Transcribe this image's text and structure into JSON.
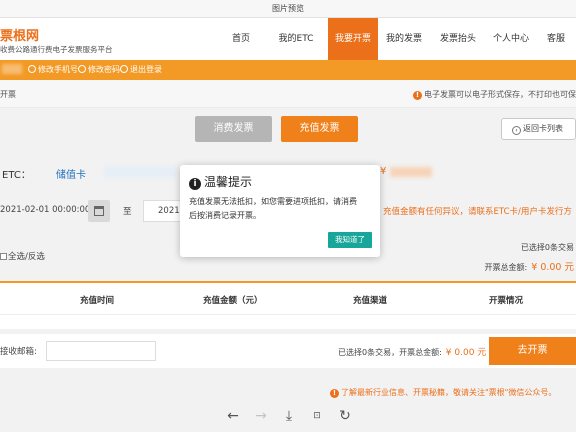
{
  "viewer": {
    "title": "图片预览",
    "tools": [
      "left-arrow-icon",
      "right-arrow-icon",
      "download-icon",
      "fit-icon",
      "rotate-icon"
    ]
  },
  "header": {
    "logo_title": "票根网",
    "logo_subtitle": "收费公路通行费电子发票服务平台",
    "nav": [
      "首页",
      "我的ETC",
      "我要开票",
      "我的发票",
      "发票抬头",
      "个人中心",
      "客服"
    ],
    "active_nav_index": 2
  },
  "user_bar": {
    "change_phone": "修改手机号",
    "change_password": "修改密码",
    "logout": "退出登录"
  },
  "breadcrumb": {
    "left": "开票",
    "notice": "电子发票可以电子形式保存，不打印也可保"
  },
  "tabs": {
    "consume": "消费发票",
    "recharge": "充值发票",
    "back": "返回卡列表"
  },
  "etc_card": {
    "label": "ETC：",
    "card_type": "储值卡",
    "amount_prefix": "¥"
  },
  "date_filter": {
    "start": "2021-02-01 00:00:00",
    "to_label": "至",
    "end": "2021-",
    "dispute_text": "充值金额有任何异议，请联系ETC卡/用户卡发行方"
  },
  "selection": {
    "select_all": "全选/反选",
    "selected_count": "已选择0条交易",
    "total_label": "开票总金额:",
    "total_value": "¥ 0.00 元"
  },
  "table": {
    "headers": [
      "充值时间",
      "充值金额（元）",
      "充值渠道",
      "开票情况"
    ]
  },
  "bottom": {
    "email_label": "接收邮箱:",
    "email_value": "",
    "summary": "已选择0条交易，开票总金额:",
    "summary_value": "¥ 0.00 元",
    "submit": "去开票"
  },
  "promo": "了解最新行业信息、开票秘籍，敬请关注\"票根\"微信公众号。",
  "modal": {
    "title": "温馨提示",
    "line1": "充值发票无法抵扣，如您需要进项抵扣，请消费",
    "line2": "后按消费记录开票。",
    "ok": "我知道了"
  },
  "colors": {
    "brand_orange": "#ec6f1a",
    "bar_orange": "#f39a26",
    "link_blue": "#1f6fbd",
    "modal_ok": "#19a69a"
  }
}
